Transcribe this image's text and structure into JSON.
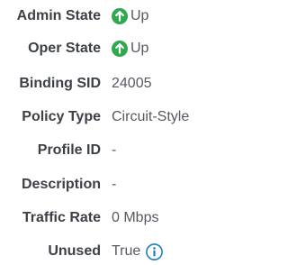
{
  "properties": {
    "admin_state": {
      "label": "Admin State",
      "value": "Up",
      "icon": "arrow-up-circle-icon"
    },
    "oper_state": {
      "label": "Oper State",
      "value": "Up",
      "icon": "arrow-up-circle-icon"
    },
    "binding_sid": {
      "label": "Binding SID",
      "value": "24005"
    },
    "policy_type": {
      "label": "Policy Type",
      "value": "Circuit-Style"
    },
    "profile_id": {
      "label": "Profile ID",
      "value": "-"
    },
    "description": {
      "label": "Description",
      "value": "-"
    },
    "traffic_rate": {
      "label": "Traffic Rate",
      "value": "0 Mbps"
    },
    "unused": {
      "label": "Unused",
      "value": "True",
      "icon": "info-icon"
    }
  },
  "colors": {
    "status_up": "#2fa84f",
    "info": "#1d7fc1",
    "label": "#3d4146",
    "value": "#555a60"
  }
}
